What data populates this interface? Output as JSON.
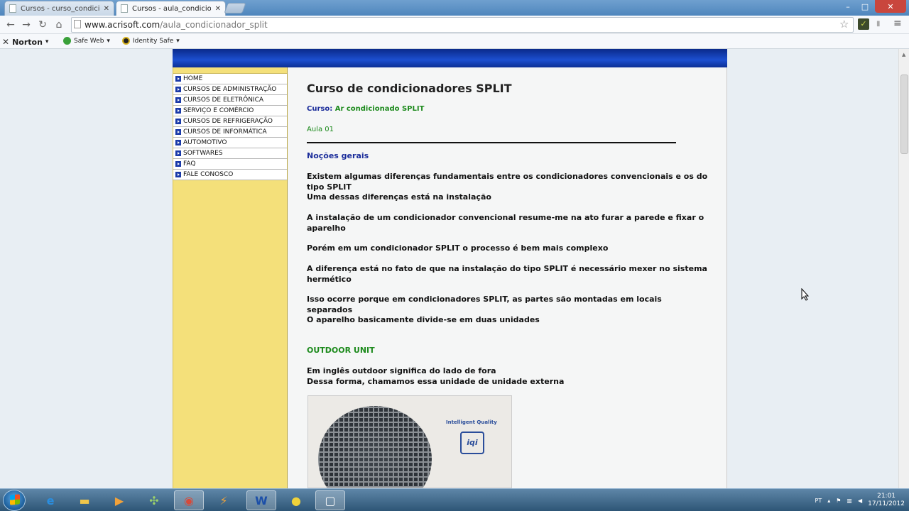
{
  "browser": {
    "tabs": [
      {
        "title": "Cursos - curso_condiciona",
        "active": false
      },
      {
        "title": "Cursos - aula_condiciona",
        "active": true
      }
    ],
    "url_domain": "www.acrisoft.com",
    "url_path": "/aula_condicionador_split",
    "bookmarks": {
      "norton": "Norton",
      "safe_web": "Safe Web",
      "identity_safe": "Identity Safe"
    },
    "window_controls": {
      "minimize": "–",
      "maximize": "□",
      "close": "✕"
    }
  },
  "sidebar": {
    "items": [
      {
        "label": "HOME"
      },
      {
        "label": "CURSOS DE ADMINISTRAÇÃO"
      },
      {
        "label": "CURSOS DE ELETRÔNICA"
      },
      {
        "label": "SERVIÇO E COMÉRCIO"
      },
      {
        "label": "CURSOS DE REFRIGERAÇÃO"
      },
      {
        "label": "CURSOS DE INFORMÁTICA"
      },
      {
        "label": "AUTOMOTIVO"
      },
      {
        "label": "SOFTWARES"
      },
      {
        "label": "FAQ"
      },
      {
        "label": "FALE CONOSCO"
      }
    ]
  },
  "content": {
    "title": "Curso de condicionadores SPLIT",
    "curso_label": "Curso:",
    "curso_value": "Ar condicionado SPLIT",
    "aula": "Aula 01",
    "section_title": "Noções gerais",
    "paragraphs": [
      "Existem algumas diferenças fundamentais entre os condicionadores convencionais e os do tipo SPLIT\nUma dessas diferenças está na instalação",
      "A instalação de um condicionador convencional resume-me na ato furar a parede e fixar o aparelho",
      "Porém em um condicionador SPLIT o processo é bem mais complexo",
      "A diferença está no fato de que na instalação do tipo SPLIT é necessário mexer no sistema hermético",
      "Isso ocorre porque em condicionadores SPLIT, as partes são montadas em locais separados",
      "O aparelho basicamente divide-se em duas unidades"
    ],
    "outdoor_title": "OUTDOOR UNIT",
    "outdoor_text": "Em inglês outdoor significa do lado de fora\nDessa forma, chamamos essa unidade de unidade externa",
    "photo": {
      "brand": "Intelligent Quality",
      "logo": "iqi"
    }
  },
  "taskbar": {
    "lang": "PT",
    "time": "21:01",
    "date": "17/11/2012",
    "apps": [
      "ie-icon",
      "explorer-icon",
      "media-player-icon",
      "network-icon",
      "chrome-icon",
      "winamp-icon",
      "word-icon",
      "game-icon",
      "window-icon"
    ]
  }
}
